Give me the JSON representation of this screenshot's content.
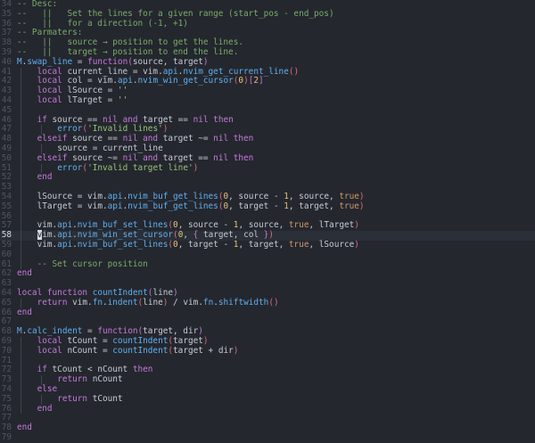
{
  "editor": {
    "cursor_line": 58,
    "lines": [
      {
        "n": "34",
        "indent": 0,
        "t": [
          [
            "cm",
            "-- Desc:"
          ]
        ]
      },
      {
        "n": "35",
        "indent": 0,
        "t": [
          [
            "cm",
            "--   ||   Set the lines for a given range (start_pos - end_pos)"
          ]
        ]
      },
      {
        "n": "36",
        "indent": 0,
        "t": [
          [
            "cm",
            "--   ||   for a direction (-1, +1)"
          ]
        ]
      },
      {
        "n": "37",
        "indent": 0,
        "t": [
          [
            "cm",
            "-- Parmaters:"
          ]
        ]
      },
      {
        "n": "38",
        "indent": 0,
        "t": [
          [
            "cm",
            "--   ||   source → position to get the lines."
          ]
        ]
      },
      {
        "n": "39",
        "indent": 0,
        "t": [
          [
            "cm",
            "--   ||   target → position to end the line."
          ]
        ]
      },
      {
        "n": "40",
        "indent": 0,
        "t": [
          [
            "mod",
            "M"
          ],
          [
            "op",
            "."
          ],
          [
            "fn",
            "swap_line"
          ],
          [
            "op",
            " = "
          ],
          [
            "kw",
            "function"
          ],
          [
            "pb",
            "("
          ],
          [
            "id",
            "source, target"
          ],
          [
            "pb",
            ")"
          ]
        ]
      },
      {
        "n": "41",
        "indent": 1,
        "t": [
          [
            "kw",
            "local "
          ],
          [
            "id",
            "current_line = vim."
          ],
          [
            "fn",
            "api"
          ],
          [
            "op",
            "."
          ],
          [
            "fn",
            "nvim_get_current_line"
          ],
          [
            "pr",
            "()"
          ]
        ]
      },
      {
        "n": "42",
        "indent": 1,
        "t": [
          [
            "kw",
            "local "
          ],
          [
            "id",
            "col = vim."
          ],
          [
            "fn",
            "api"
          ],
          [
            "op",
            "."
          ],
          [
            "fn",
            "nvim_win_get_cursor"
          ],
          [
            "pr",
            "("
          ],
          [
            "num",
            "0"
          ],
          [
            "pr",
            ")"
          ],
          [
            "pb",
            "["
          ],
          [
            "num",
            "2"
          ],
          [
            "pb",
            "]"
          ]
        ]
      },
      {
        "n": "43",
        "indent": 1,
        "t": [
          [
            "kw",
            "local "
          ],
          [
            "id",
            "lSource = "
          ],
          [
            "str",
            "''"
          ]
        ]
      },
      {
        "n": "44",
        "indent": 1,
        "t": [
          [
            "kw",
            "local "
          ],
          [
            "id",
            "lTarget = "
          ],
          [
            "str",
            "''"
          ]
        ]
      },
      {
        "n": "45",
        "indent": 1,
        "t": []
      },
      {
        "n": "46",
        "indent": 1,
        "t": [
          [
            "kw",
            "if "
          ],
          [
            "id",
            "source == "
          ],
          [
            "kw",
            "nil "
          ],
          [
            "kw",
            "and "
          ],
          [
            "id",
            "target == "
          ],
          [
            "kw",
            "nil "
          ],
          [
            "kw",
            "then"
          ]
        ]
      },
      {
        "n": "47",
        "indent": 2,
        "t": [
          [
            "fn",
            "error"
          ],
          [
            "pr",
            "("
          ],
          [
            "str",
            "'Invalid lines'"
          ],
          [
            "pr",
            ")"
          ]
        ]
      },
      {
        "n": "48",
        "indent": 1,
        "t": [
          [
            "kw",
            "elseif "
          ],
          [
            "id",
            "source == "
          ],
          [
            "kw",
            "nil "
          ],
          [
            "kw",
            "and "
          ],
          [
            "id",
            "target ~= "
          ],
          [
            "kw",
            "nil "
          ],
          [
            "kw",
            "then"
          ]
        ]
      },
      {
        "n": "49",
        "indent": 2,
        "t": [
          [
            "id",
            "source = current_line"
          ]
        ]
      },
      {
        "n": "50",
        "indent": 1,
        "t": [
          [
            "kw",
            "elseif "
          ],
          [
            "id",
            "source ~= "
          ],
          [
            "kw",
            "nil "
          ],
          [
            "kw",
            "and "
          ],
          [
            "id",
            "target == "
          ],
          [
            "kw",
            "nil "
          ],
          [
            "kw",
            "then"
          ]
        ]
      },
      {
        "n": "51",
        "indent": 2,
        "t": [
          [
            "fn",
            "error"
          ],
          [
            "pr",
            "("
          ],
          [
            "str",
            "'Invalid target line'"
          ],
          [
            "pr",
            ")"
          ]
        ]
      },
      {
        "n": "52",
        "indent": 1,
        "t": [
          [
            "kw",
            "end"
          ]
        ]
      },
      {
        "n": "53",
        "indent": 1,
        "t": []
      },
      {
        "n": "54",
        "indent": 1,
        "t": [
          [
            "id",
            "lSource = vim."
          ],
          [
            "fn",
            "api"
          ],
          [
            "op",
            "."
          ],
          [
            "fn",
            "nvim_buf_get_lines"
          ],
          [
            "pr",
            "("
          ],
          [
            "num",
            "0"
          ],
          [
            "id",
            ", source - "
          ],
          [
            "num",
            "1"
          ],
          [
            "id",
            ", source, "
          ],
          [
            "bool",
            "true"
          ],
          [
            "pr",
            ")"
          ]
        ]
      },
      {
        "n": "55",
        "indent": 1,
        "t": [
          [
            "id",
            "lTarget = vim."
          ],
          [
            "fn",
            "api"
          ],
          [
            "op",
            "."
          ],
          [
            "fn",
            "nvim_buf_get_lines"
          ],
          [
            "pr",
            "("
          ],
          [
            "num",
            "0"
          ],
          [
            "id",
            ", target - "
          ],
          [
            "num",
            "1"
          ],
          [
            "id",
            ", target, "
          ],
          [
            "bool",
            "true"
          ],
          [
            "pr",
            ")"
          ]
        ]
      },
      {
        "n": "56",
        "indent": 1,
        "t": []
      },
      {
        "n": "57",
        "indent": 1,
        "t": [
          [
            "id",
            "vim."
          ],
          [
            "fn",
            "api"
          ],
          [
            "op",
            "."
          ],
          [
            "fn",
            "nvim_buf_set_lines"
          ],
          [
            "pr",
            "("
          ],
          [
            "num",
            "0"
          ],
          [
            "id",
            ", source - "
          ],
          [
            "num",
            "1"
          ],
          [
            "id",
            ", source, "
          ],
          [
            "bool",
            "true"
          ],
          [
            "id",
            ", lTarget"
          ],
          [
            "pr",
            ")"
          ]
        ]
      },
      {
        "n": "58",
        "indent": 1,
        "t": [
          [
            "cursor",
            "v"
          ],
          [
            "id",
            "im."
          ],
          [
            "fn",
            "api"
          ],
          [
            "op",
            "."
          ],
          [
            "fn",
            "nvim_win_set_cursor"
          ],
          [
            "pr",
            "("
          ],
          [
            "num",
            "0"
          ],
          [
            "id",
            ", "
          ],
          [
            "pb",
            "{"
          ],
          [
            "id",
            " target, col "
          ],
          [
            "pb",
            "}"
          ],
          [
            "pr",
            ")"
          ]
        ]
      },
      {
        "n": "59",
        "indent": 1,
        "t": [
          [
            "id",
            "vim."
          ],
          [
            "fn",
            "api"
          ],
          [
            "op",
            "."
          ],
          [
            "fn",
            "nvim_buf_set_lines"
          ],
          [
            "pr",
            "("
          ],
          [
            "num",
            "0"
          ],
          [
            "id",
            ", target - "
          ],
          [
            "num",
            "1"
          ],
          [
            "id",
            ", target, "
          ],
          [
            "bool",
            "true"
          ],
          [
            "id",
            ", lSource"
          ],
          [
            "pr",
            ")"
          ]
        ]
      },
      {
        "n": "60",
        "indent": 1,
        "t": []
      },
      {
        "n": "61",
        "indent": 1,
        "t": [
          [
            "cm",
            "-- Set cursor position"
          ]
        ]
      },
      {
        "n": "62",
        "indent": 0,
        "t": [
          [
            "kw",
            "end"
          ]
        ]
      },
      {
        "n": "63",
        "indent": 0,
        "t": []
      },
      {
        "n": "64",
        "indent": 0,
        "t": [
          [
            "kw",
            "local "
          ],
          [
            "kw",
            "function "
          ],
          [
            "fn",
            "countIndent"
          ],
          [
            "pb",
            "("
          ],
          [
            "id",
            "line"
          ],
          [
            "pb",
            ")"
          ]
        ]
      },
      {
        "n": "65",
        "indent": 1,
        "t": [
          [
            "kw",
            "return "
          ],
          [
            "id",
            "vim."
          ],
          [
            "fn",
            "fn"
          ],
          [
            "op",
            "."
          ],
          [
            "fn",
            "indent"
          ],
          [
            "pr",
            "("
          ],
          [
            "id",
            "line"
          ],
          [
            "pr",
            ")"
          ],
          [
            "id",
            " / vim."
          ],
          [
            "fn",
            "fn"
          ],
          [
            "op",
            "."
          ],
          [
            "fn",
            "shiftwidth"
          ],
          [
            "pr",
            "()"
          ]
        ]
      },
      {
        "n": "66",
        "indent": 0,
        "t": [
          [
            "kw",
            "end"
          ]
        ]
      },
      {
        "n": "67",
        "indent": 0,
        "t": []
      },
      {
        "n": "68",
        "indent": 0,
        "t": [
          [
            "mod",
            "M"
          ],
          [
            "op",
            "."
          ],
          [
            "fn",
            "calc_indent"
          ],
          [
            "op",
            " = "
          ],
          [
            "kw",
            "function"
          ],
          [
            "pb",
            "("
          ],
          [
            "id",
            "target, dir"
          ],
          [
            "pb",
            ")"
          ]
        ]
      },
      {
        "n": "69",
        "indent": 1,
        "t": [
          [
            "kw",
            "local "
          ],
          [
            "id",
            "tCount = "
          ],
          [
            "fn",
            "countIndent"
          ],
          [
            "pr",
            "("
          ],
          [
            "id",
            "target"
          ],
          [
            "pr",
            ")"
          ]
        ]
      },
      {
        "n": "70",
        "indent": 1,
        "t": [
          [
            "kw",
            "local "
          ],
          [
            "id",
            "nCount = "
          ],
          [
            "fn",
            "countIndent"
          ],
          [
            "pr",
            "("
          ],
          [
            "id",
            "target + dir"
          ],
          [
            "pr",
            ")"
          ]
        ]
      },
      {
        "n": "71",
        "indent": 1,
        "t": []
      },
      {
        "n": "72",
        "indent": 1,
        "t": [
          [
            "kw",
            "if "
          ],
          [
            "id",
            "tCount < nCount "
          ],
          [
            "kw",
            "then"
          ]
        ]
      },
      {
        "n": "73",
        "indent": 2,
        "t": [
          [
            "kw",
            "return "
          ],
          [
            "id",
            "nCount"
          ]
        ]
      },
      {
        "n": "74",
        "indent": 1,
        "t": [
          [
            "kw",
            "else"
          ]
        ]
      },
      {
        "n": "75",
        "indent": 2,
        "t": [
          [
            "kw",
            "return "
          ],
          [
            "id",
            "tCount"
          ]
        ]
      },
      {
        "n": "76",
        "indent": 1,
        "t": [
          [
            "kw",
            "end"
          ]
        ]
      },
      {
        "n": "77",
        "indent": 0,
        "t": []
      },
      {
        "n": "78",
        "indent": 0,
        "t": [
          [
            "kw",
            "end"
          ]
        ]
      },
      {
        "n": "79",
        "indent": 0,
        "t": []
      }
    ]
  }
}
